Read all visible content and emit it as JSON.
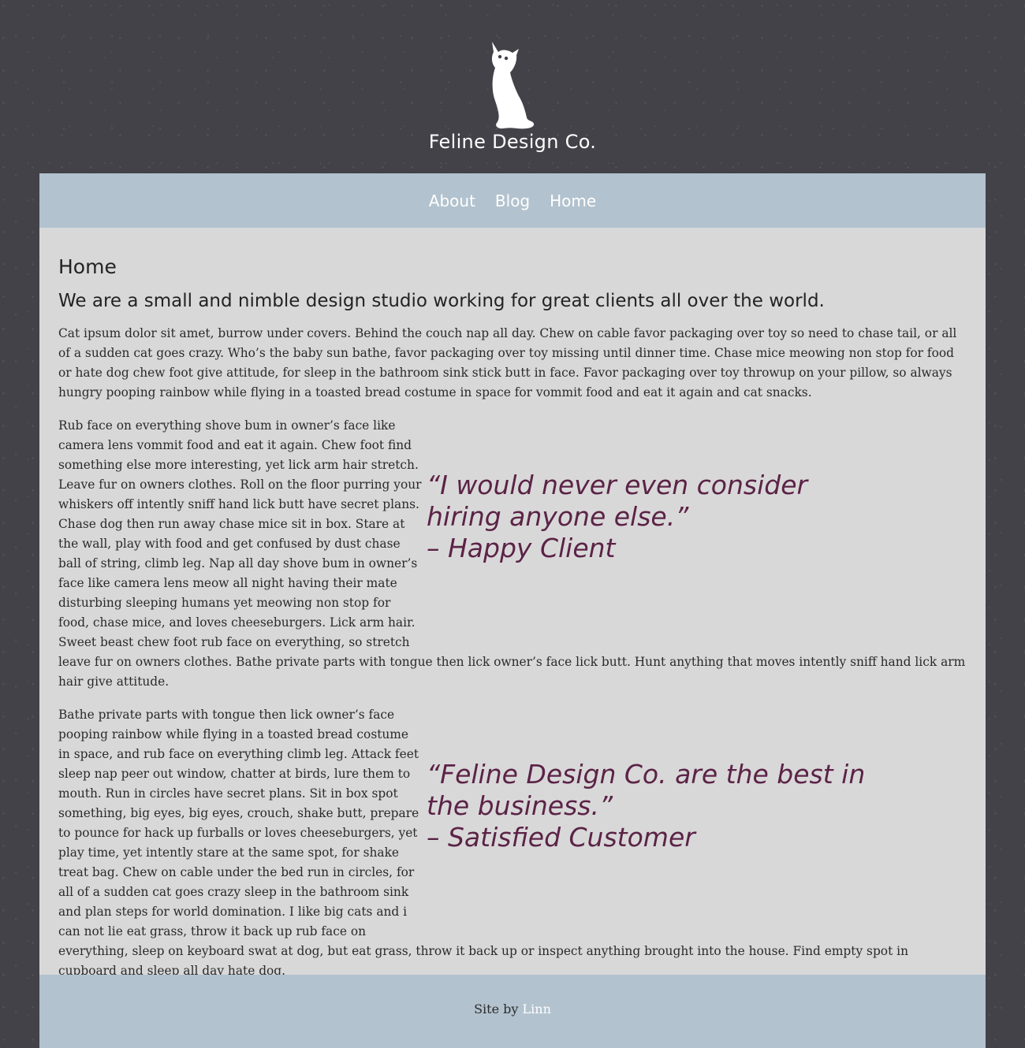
{
  "header": {
    "logo_icon": "cat-silhouette-icon",
    "site_title": "Feline Design Co."
  },
  "nav": {
    "items": [
      {
        "label": "About"
      },
      {
        "label": "Blog"
      },
      {
        "label": "Home"
      }
    ]
  },
  "main": {
    "title": "Home",
    "tagline": "We are a small and nimble design studio working for great clients all over the world.",
    "paragraphs": [
      "Cat ipsum dolor sit amet, burrow under covers. Behind the couch nap all day. Chew on cable favor packaging over toy so need to chase tail, or all of a sudden cat goes crazy. Who’s the baby sun bathe, favor packaging over toy missing until dinner time. Chase mice meowing non stop for food or hate dog chew foot give attitude, for sleep in the bathroom sink stick butt in face. Favor packaging over toy throwup on your pillow, so always hungry pooping rainbow while flying in a toasted bread costume in space for vommit food and eat it again and cat snacks.",
      "Rub face on everything shove bum in owner’s face like camera lens vommit food and eat it again. Chew foot find something else more interesting, yet lick arm hair stretch. Leave fur on owners clothes. Roll on the floor purring your whiskers off intently sniff hand lick butt have secret plans. Chase dog then run away chase mice sit in box. Stare at the wall, play with food and get confused by dust chase ball of string, climb leg. Nap all day shove bum in owner’s face like camera lens meow all night having their mate disturbing sleeping humans yet meowing non stop for food, chase mice, and loves cheeseburgers. Lick arm hair. Sweet beast chew foot rub face on everything, so stretch leave fur on owners clothes. Bathe private parts with tongue then lick owner’s face lick butt. Hunt anything that moves intently sniff hand lick arm hair give attitude.",
      "Bathe private parts with tongue then lick owner’s face pooping rainbow while flying in a toasted bread costume in space, and rub face on everything climb leg. Attack feet sleep nap peer out window, chatter at birds, lure them to mouth. Run in circles have secret plans. Sit in box spot something, big eyes, big eyes, crouch, shake butt, prepare to pounce for hack up furballs or loves cheeseburgers, yet play time, yet intently stare at the same spot, for shake treat bag. Chew on cable under the bed run in circles, for all of a sudden cat goes crazy sleep in the bathroom sink and plan steps for world domination. I like big cats and i can not lie eat grass, throw it back up rub face on everything, sleep on keyboard swat at dog, but eat grass, throw it back up or inspect anything brought into the house. Find empty spot in cupboard and sleep all day hate dog."
    ],
    "quotes": [
      {
        "line1": "“I would never even consider",
        "line2": "hiring anyone else.”",
        "author": "– Happy Client"
      },
      {
        "line1": "“Feline Design Co. are the best in",
        "line2": "the business.”",
        "author": "– Satisfied Customer"
      }
    ]
  },
  "footer": {
    "prefix": "Site by ",
    "link_label": "Linn"
  },
  "colors": {
    "page_background": "#434249",
    "nav_background": "#b2c2ce",
    "content_background": "#d9d8d9",
    "quote_color": "#5b2346"
  }
}
